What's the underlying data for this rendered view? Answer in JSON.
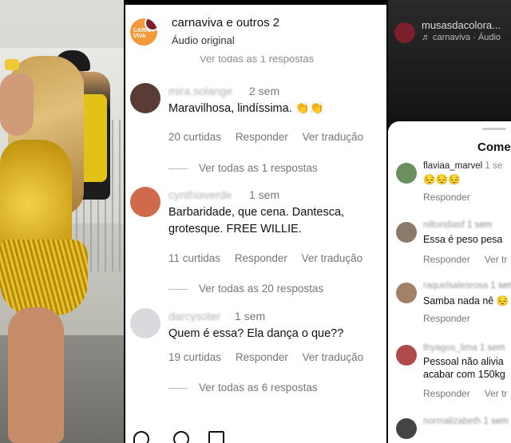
{
  "left_photo": {
    "alt": "carnival dancer in gold costume"
  },
  "middle": {
    "header": {
      "title": "carnaviva e outros 2",
      "subtitle": "Áudio original",
      "avatar_text": "CARNA VIVA"
    },
    "faded_top": "Ver todas as 1 respostas",
    "comments": [
      {
        "user": "mira.solange",
        "time": "2 sem",
        "text": "Maravilhosa, lindíssima. 👏👏",
        "likes": "20 curtidas",
        "reply": "Responder",
        "translate": "Ver tradução",
        "replies": "Ver todas as 1 respostas",
        "avatar_color": "#5a3b35"
      },
      {
        "user": "cynthiaverde",
        "time": "1 sem",
        "text": "Barbaridade, que cena. Dantesca, grotesque. FREE WILLIE.",
        "likes": "11 curtidas",
        "reply": "Responder",
        "translate": "Ver tradução",
        "replies": "Ver todas as 20 respostas",
        "avatar_color": "#d06a4a"
      },
      {
        "user": "darcysoter",
        "time": "1 sem",
        "text": "Quem é essa? Ela dança o que??",
        "likes": "19 curtidas",
        "reply": "Responder",
        "translate": "Ver tradução",
        "replies": "Ver todas as 6 respostas",
        "avatar_color": "#d9d9de"
      }
    ]
  },
  "right": {
    "account": "musasdacolora...",
    "audio": "♬ carnaviva · Áudio",
    "sheet_title": "Come",
    "comments": [
      {
        "user": "flaviaa_marvel",
        "time": "1 se",
        "text": "😔😔😔",
        "action": "Responder",
        "translate": "",
        "blur": false,
        "avatar_color": "#6b8f5e"
      },
      {
        "user": "niltondiasf",
        "time": "1 sem",
        "text": "Essa é peso pesa",
        "action": "Responder",
        "translate": "Ver tr",
        "blur": true,
        "avatar_color": "#8a7a6a"
      },
      {
        "user": "raquelsalesrosa",
        "time": "1 sem",
        "text": "Samba nada nê 😔",
        "action": "Responder",
        "translate": "",
        "blur": true,
        "avatar_color": "#a2806a"
      },
      {
        "user": "thyagos_lima",
        "time": "1 sem",
        "text": "Pessoal não alivia",
        "text2": "acabar com 150kg",
        "action": "Responder",
        "translate": "Ver tr",
        "blur": true,
        "avatar_color": "#b04a4a"
      },
      {
        "user": "normalizabeth",
        "time": "1 sem",
        "text": "",
        "action": "",
        "translate": "",
        "blur": true,
        "avatar_color": "#444"
      }
    ]
  }
}
